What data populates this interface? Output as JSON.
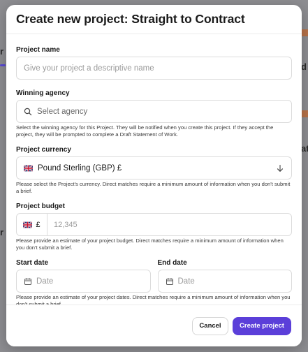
{
  "modal": {
    "title": "Create new project: Straight to Contract"
  },
  "fields": {
    "project_name": {
      "label": "Project name",
      "placeholder": "Give your project a descriptive name"
    },
    "winning_agency": {
      "label": "Winning agency",
      "placeholder": "Select agency",
      "help": "Select the winning agency for this Project. They will be notified when you create this project. If they accept the project, they will be prompted to complete a Draft Statement of Work."
    },
    "project_currency": {
      "label": "Project currency",
      "value": "Pound Sterling (GBP) £",
      "help": "Please select the Project's currency. Direct matches require a minimum amount of information when you don't submit a brief."
    },
    "project_budget": {
      "label": "Project budget",
      "currency_symbol": "£",
      "placeholder": "12,345",
      "help": "Please provide an estimate of your project budget. Direct matches require a minimum amount of information when you don't submit a brief."
    },
    "start_date": {
      "label": "Start date",
      "placeholder": "Date"
    },
    "end_date": {
      "label": "End date",
      "placeholder": "Date"
    },
    "dates_help": "Please provide an estimate of your project dates. Direct matches require a minimum amount of information when you don't submit a brief."
  },
  "footer": {
    "cancel_label": "Cancel",
    "create_label": "Create project"
  },
  "colors": {
    "primary": "#5b3fd9",
    "overlay": "#8e8e92"
  },
  "icons": [
    "search-icon",
    "chevron-down-icon",
    "uk-flag-icon",
    "calendar-icon"
  ]
}
